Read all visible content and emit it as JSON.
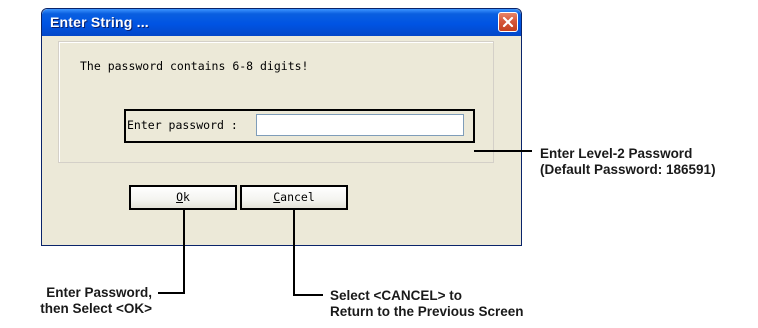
{
  "dialog": {
    "title": "Enter String ...",
    "info_text": "The password contains 6-8 digits!",
    "password_label": "Enter password :",
    "password_value": "",
    "ok_mnemonic": "O",
    "ok_rest": "k",
    "cancel_mnemonic": "C",
    "cancel_rest": "ancel"
  },
  "annotations": {
    "password_line1": "Enter Level-2 Password",
    "password_line2": "(Default Password: 186591)",
    "ok_line1": "Enter Password,",
    "ok_line2": "then Select <OK>",
    "cancel_line1": "Select <CANCEL> to",
    "cancel_line2": "Return to the Previous Screen"
  },
  "colors": {
    "titlebar": "#0054e3",
    "window_body": "#ece9d8",
    "close_button": "#d6573a",
    "input_border": "#7f9db9"
  },
  "icons": {
    "close": "close-x-icon"
  }
}
